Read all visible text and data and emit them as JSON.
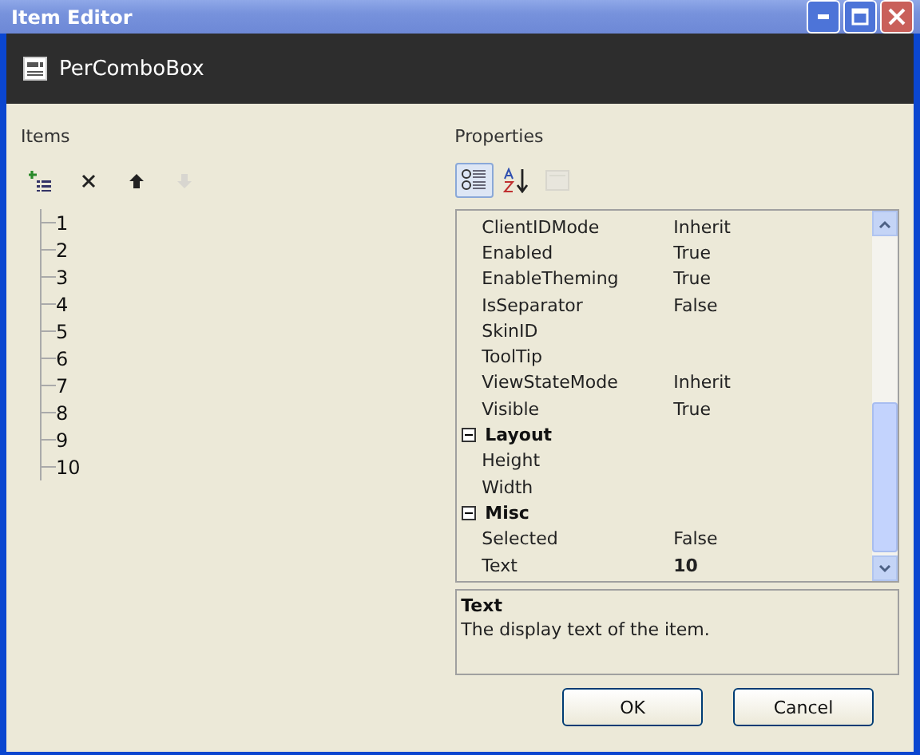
{
  "window": {
    "title": "Item Editor"
  },
  "header": {
    "title": "PerComboBox"
  },
  "items_panel": {
    "label": "Items",
    "toolbar": [
      {
        "kind": "add",
        "disabled": false
      },
      {
        "kind": "delete",
        "disabled": false
      },
      {
        "kind": "up",
        "disabled": false
      },
      {
        "kind": "down",
        "disabled": true
      }
    ],
    "items": [
      "1",
      "2",
      "3",
      "4",
      "5",
      "6",
      "7",
      "8",
      "9",
      "10"
    ]
  },
  "properties_panel": {
    "label": "Properties",
    "toolbar": [
      {
        "kind": "categorized",
        "selected": true,
        "disabled": false
      },
      {
        "kind": "alphabetical",
        "selected": false,
        "disabled": false
      },
      {
        "kind": "pages",
        "selected": false,
        "disabled": true
      }
    ],
    "rows": [
      {
        "kind": "property",
        "name": "ClientIDMode",
        "value": "Inherit",
        "modified": false
      },
      {
        "kind": "property",
        "name": "Enabled",
        "value": "True",
        "modified": false
      },
      {
        "kind": "property",
        "name": "EnableTheming",
        "value": "True",
        "modified": false
      },
      {
        "kind": "property",
        "name": "IsSeparator",
        "value": "False",
        "modified": false
      },
      {
        "kind": "property",
        "name": "SkinID"
      },
      {
        "kind": "property",
        "name": "ToolTip"
      },
      {
        "kind": "property",
        "name": "ViewStateMode",
        "value": "Inherit",
        "modified": false
      },
      {
        "kind": "property",
        "name": "Visible",
        "value": "True",
        "modified": false
      },
      {
        "kind": "category",
        "name": "Layout",
        "expanded": true
      },
      {
        "kind": "property",
        "name": "Height"
      },
      {
        "kind": "property",
        "name": "Width"
      },
      {
        "kind": "category",
        "name": "Misc",
        "expanded": true
      },
      {
        "kind": "property",
        "name": "Selected",
        "value": "False",
        "modified": false
      },
      {
        "kind": "property",
        "name": "Text",
        "value": "10",
        "modified": true
      }
    ],
    "description": {
      "title": "Text",
      "text": "The display text of the item."
    }
  },
  "buttons": [
    "OK",
    "Cancel"
  ]
}
